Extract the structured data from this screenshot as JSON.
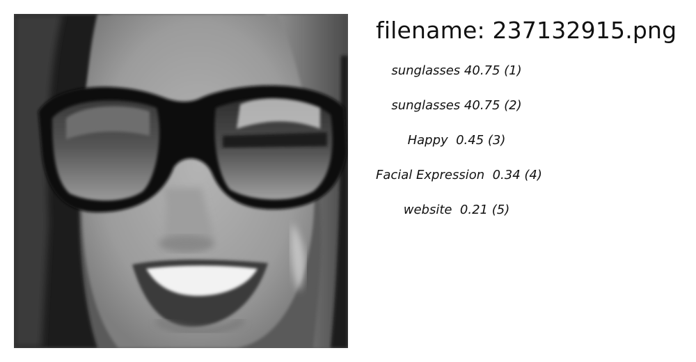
{
  "filename_label": "filename: 237132915.png",
  "image": {
    "subject": "grayscale close-up of a smiling woman wearing large dark sunglasses",
    "icon": "photo"
  },
  "labels": [
    {
      "text": "sunglasses 40.75 (1)"
    },
    {
      "text": "sunglasses 40.75 (2)"
    },
    {
      "text": "Happy  0.45 (3)"
    },
    {
      "text": "Facial Expression  0.34 (4)"
    },
    {
      "text": "website  0.21 (5)"
    }
  ]
}
